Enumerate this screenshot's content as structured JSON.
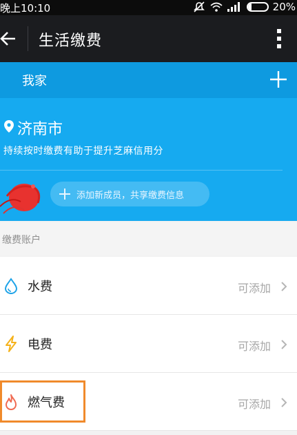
{
  "statusbar": {
    "time": "晚上10:10",
    "battery_percent": "20%",
    "battery_level": 0.2
  },
  "toolbar": {
    "title": "生活缴费",
    "back_icon": "arrow-left-icon",
    "more_icon": "vertical-dots-icon"
  },
  "home": {
    "name": "我家",
    "add_icon": "plus-icon"
  },
  "city_card": {
    "city": "济南市",
    "tip": "持续按时缴费有助于提升芝麻信用分",
    "add_member": "添加新成员，共享缴费信息"
  },
  "section": {
    "label": "缴费账户"
  },
  "accounts": [
    {
      "label": "水费",
      "action": "可添加",
      "icon": "water-drop-icon",
      "color": "#1ea3e8"
    },
    {
      "label": "电费",
      "action": "可添加",
      "icon": "lightning-icon",
      "color": "#f5b21b"
    },
    {
      "label": "燃气费",
      "action": "可添加",
      "icon": "flame-icon",
      "color": "#f06b52"
    }
  ],
  "colors": {
    "accent_blue": "#16aaf0",
    "header_blue": "#0e9ae0",
    "toolbar_dark": "#1b1c1f",
    "highlight_orange": "#f08a2b"
  }
}
